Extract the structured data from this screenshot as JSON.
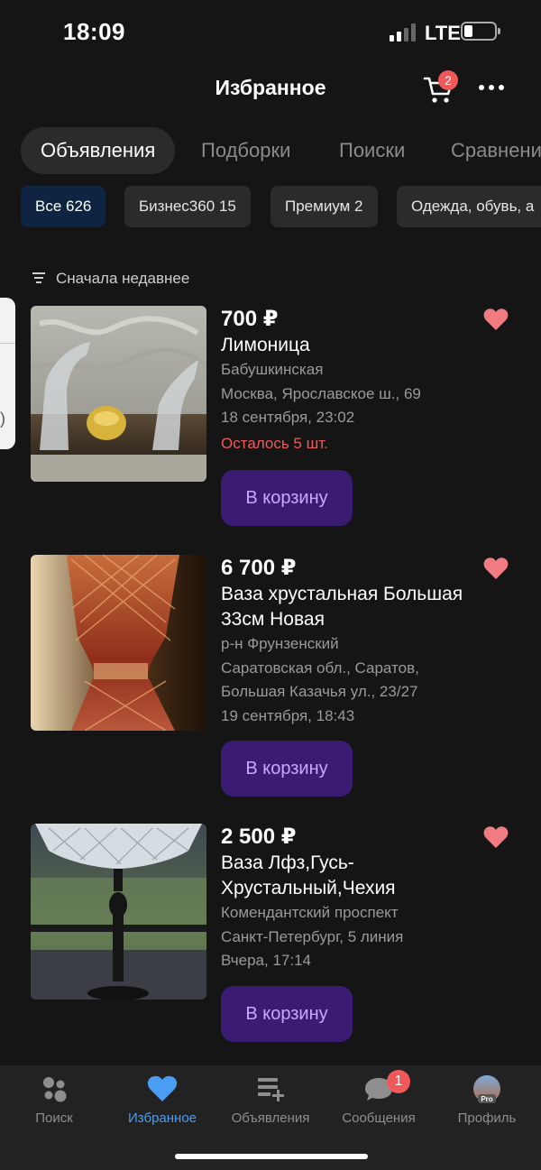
{
  "status_bar": {
    "time": "18:09",
    "network": "LTE"
  },
  "header": {
    "title": "Избранное",
    "cart_count": "2"
  },
  "tabs": [
    {
      "label": "Объявления",
      "active": true
    },
    {
      "label": "Подборки",
      "active": false
    },
    {
      "label": "Поиски",
      "active": false
    },
    {
      "label": "Сравнени",
      "active": false
    }
  ],
  "chips": [
    {
      "label": "Все 626",
      "active": true
    },
    {
      "label": "Бизнес360 15",
      "active": false
    },
    {
      "label": "Премиум 2",
      "active": false
    },
    {
      "label": "Одежда, обувь, а",
      "active": false
    }
  ],
  "sort": {
    "label": "Сначала недавнее"
  },
  "listings": [
    {
      "price": "700 ₽",
      "title": "Лимоница",
      "meta": [
        "Бабушкинская",
        "Москва, Ярославское ш., 69",
        "18 сентября, 23:02"
      ],
      "warning": "Осталось 5 шт.",
      "button": "В корзину"
    },
    {
      "price": "6 700 ₽",
      "title": "Ваза хрустальная Большая 33см Новая",
      "meta": [
        "р-н Фрунзенский",
        "Саратовская обл., Саратов, Большая Казачья ул., 23/27",
        "19 сентября, 18:43"
      ],
      "warning": "",
      "button": "В корзину"
    },
    {
      "price": "2 500 ₽",
      "title": "Ваза Лфз,Гусь-Хрустальный,Чехия",
      "meta": [
        "Комендантский проспект",
        "Санкт-Петербург, 5 линия",
        "Вчера, 17:14"
      ],
      "warning": "",
      "button": "В корзину"
    }
  ],
  "bottom_nav": [
    {
      "label": "Поиск",
      "icon": "search-dots-icon",
      "active": false
    },
    {
      "label": "Избранное",
      "icon": "heart-icon",
      "active": true
    },
    {
      "label": "Объявления",
      "icon": "add-listing-icon",
      "active": false
    },
    {
      "label": "Сообщения",
      "icon": "chat-bubble-icon",
      "active": false,
      "badge": "1"
    },
    {
      "label": "Профиль",
      "icon": "avatar-icon",
      "active": false,
      "tag": "Pro"
    }
  ],
  "colors": {
    "accent": "#4a9df3",
    "button_bg": "#3a1d72",
    "button_text": "#c9a8ff",
    "warning": "#f0595a",
    "heart": "#f07c82"
  }
}
